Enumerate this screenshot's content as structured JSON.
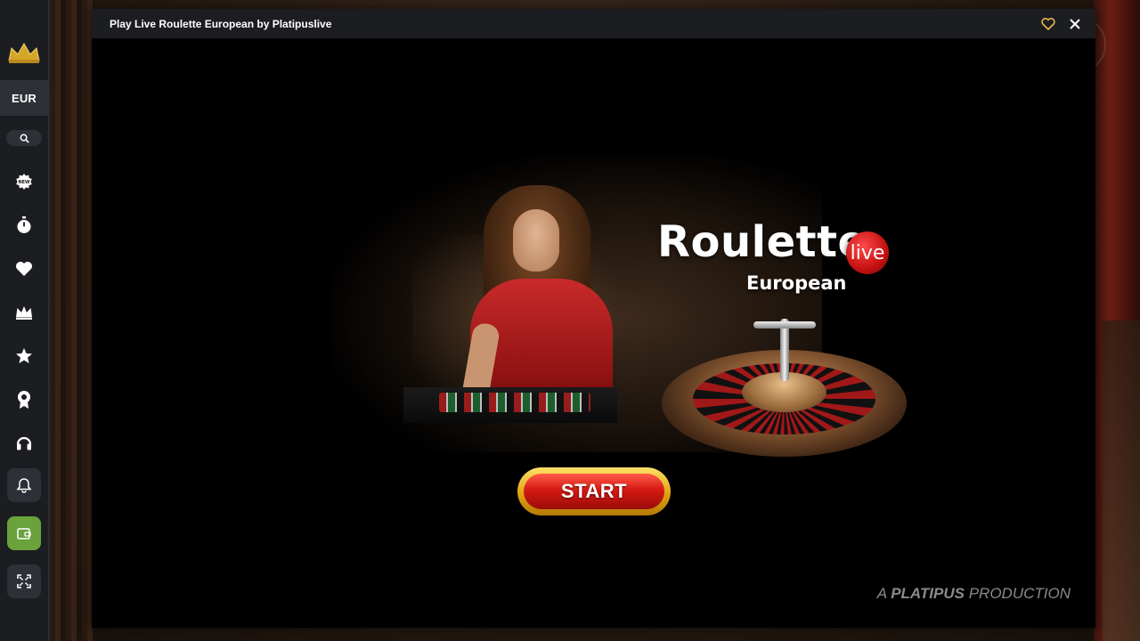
{
  "window": {
    "title": "Play Live Roulette European by Platipuslive"
  },
  "sidebar": {
    "currency": "EUR",
    "items": [
      {
        "icon": "new-badge-icon"
      },
      {
        "icon": "stopwatch-icon"
      },
      {
        "icon": "heart-icon"
      },
      {
        "icon": "crown-icon"
      },
      {
        "icon": "star-icon"
      },
      {
        "icon": "award-icon"
      },
      {
        "icon": "headset-icon"
      }
    ]
  },
  "game": {
    "logo_title": "Roulette",
    "logo_badge": "live",
    "logo_subtitle": "European",
    "start_label": "START",
    "production_prefix": "A ",
    "production_brand": "PLATIPUS",
    "production_suffix": " PRODUCTION"
  },
  "colors": {
    "sidebar_bg": "#1b1d21",
    "wallet_green": "#6aa23c",
    "start_red": "#d51a12",
    "start_gold": "#e0a312"
  }
}
